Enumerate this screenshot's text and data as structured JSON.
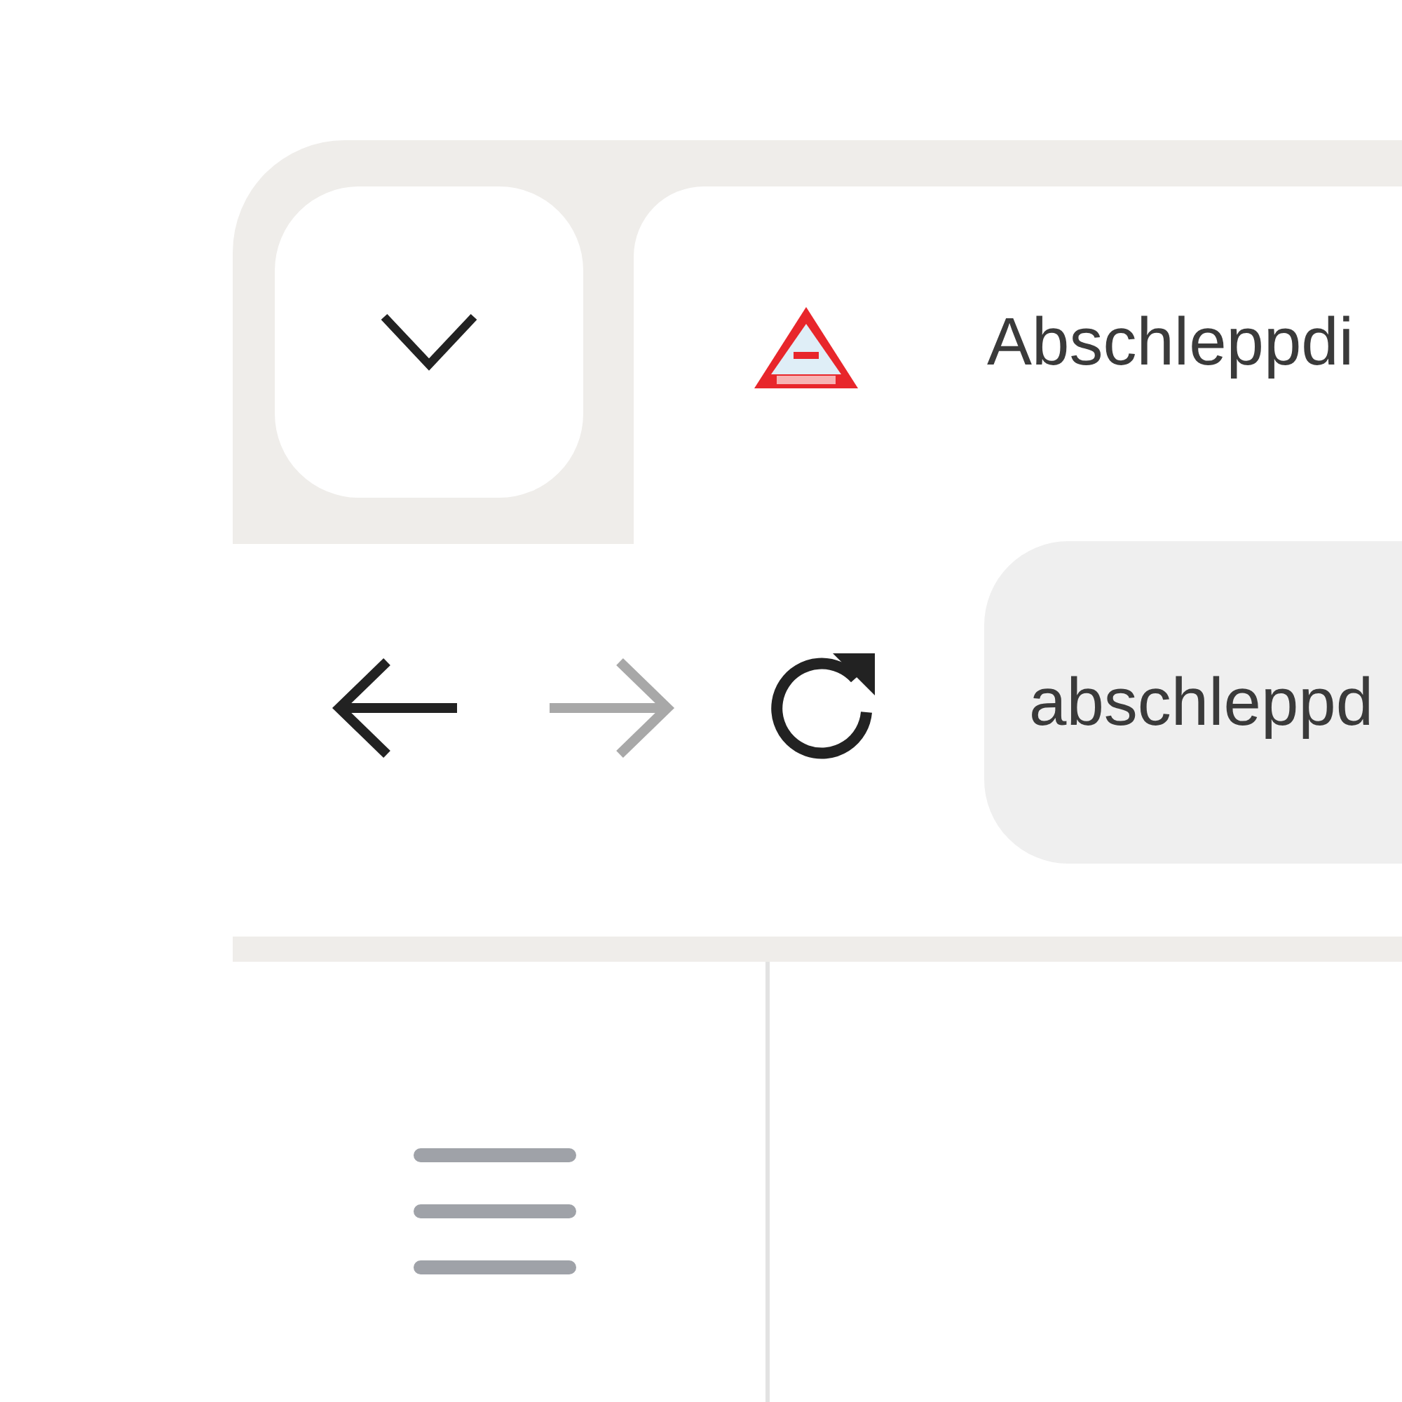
{
  "tab": {
    "title": "Abschleppdi"
  },
  "toolbar": {
    "back": {
      "disabled": false
    },
    "forward": {
      "disabled": true
    },
    "address": {
      "value": "abschleppd"
    }
  }
}
